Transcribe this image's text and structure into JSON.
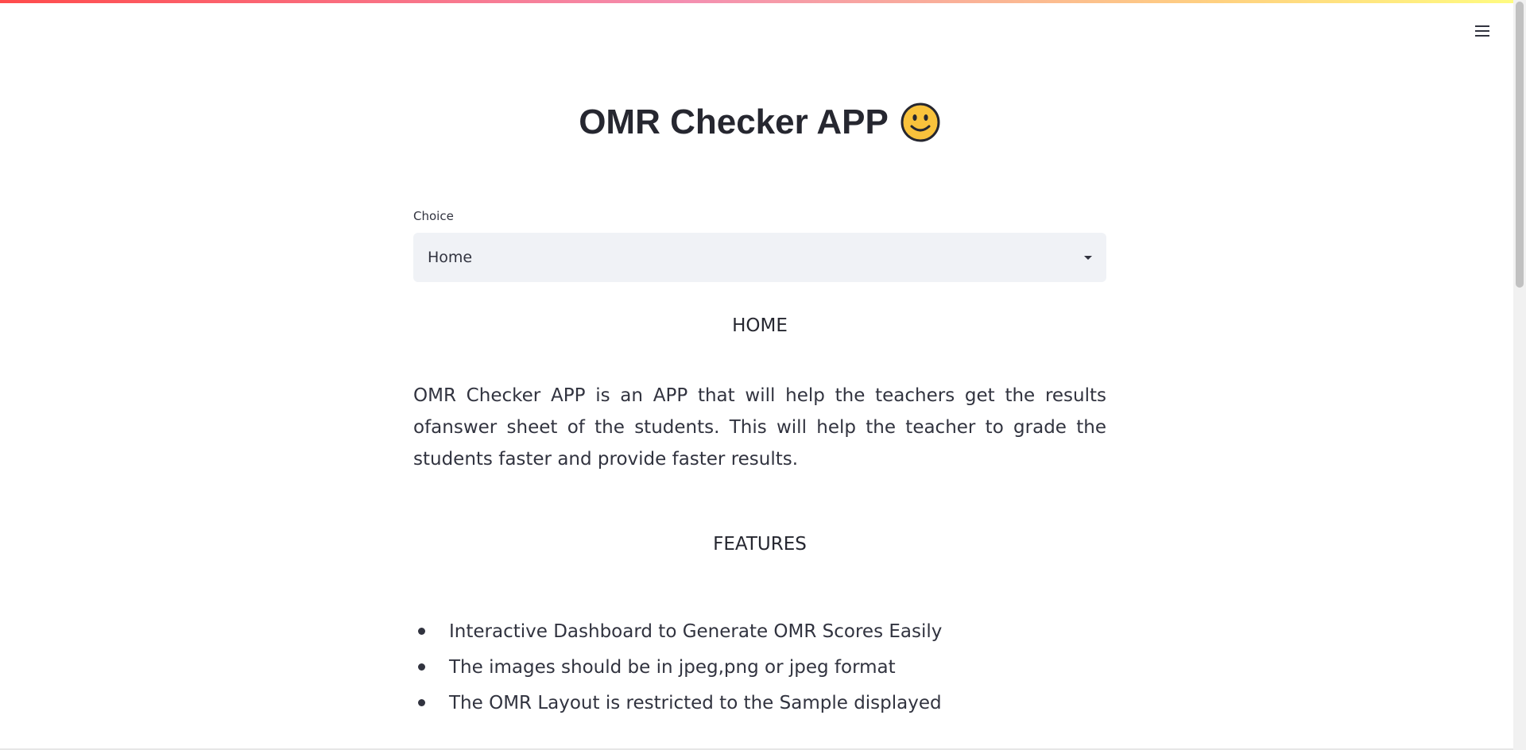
{
  "header": {
    "menu_icon": "hamburger-menu-icon"
  },
  "main": {
    "title": "OMR Checker APP",
    "title_emoji": "smiling-face-icon",
    "select": {
      "label": "Choice",
      "value": "Home"
    },
    "home_heading": "HOME",
    "intro": "OMR Checker APP is an APP that will help the teachers get the results ofanswer sheet of the students. This will help the teacher to grade the students faster and provide faster results.",
    "features_heading": "FEATURES",
    "features": [
      "Interactive Dashboard to Generate OMR Scores Easily",
      "The images should be in jpeg,png or jpeg format",
      "The OMR Layout is restricted to the Sample displayed"
    ]
  },
  "colors": {
    "accent_gradient_start": "#ff4b4b",
    "accent_gradient_end": "#fffd80",
    "select_background": "#f0f2f6",
    "text": "#31333f"
  }
}
